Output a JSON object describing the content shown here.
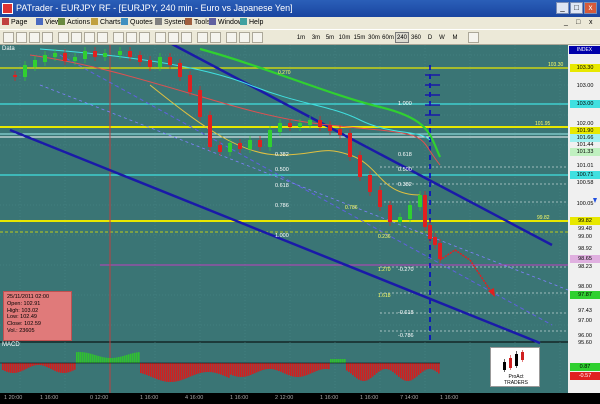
{
  "window": {
    "title": "PATrader - EURJPY RF - [EURJPY, 240 min - Euro vs Japanese Yen]",
    "minimize": "_",
    "maximize": "□",
    "close": "x"
  },
  "menu": [
    "Page",
    "View",
    "Actions",
    "Charts",
    "Quotes",
    "System",
    "Tools",
    "Window",
    "Help"
  ],
  "menu_right": {
    "minimize": "_",
    "restore": "□",
    "close": "x"
  },
  "toolbar": {
    "timeframes": [
      "1m",
      "3m",
      "5m",
      "10m",
      "15m",
      "30m",
      "60m",
      "240",
      "360"
    ],
    "periods": [
      "D",
      "W",
      "M"
    ]
  },
  "chart": {
    "panel_label": "Data",
    "macd_label": "MACD",
    "index_label": "INDEX",
    "info": {
      "date": "25/11/2011 02:00",
      "open": "Open: 102.91",
      "high": "High: 103.02",
      "low": "Low: 102.49",
      "close": "Close: 102.59",
      "vol": "Vol.: 23605"
    },
    "price_labels": [
      "103.30",
      "103.00",
      "102.00",
      "101.90",
      "101.66",
      "101.44",
      "101.33",
      "101.01",
      "100.71",
      "100.58",
      "100.05",
      "99.82",
      "99.48",
      "99.00",
      "98.92",
      "98.65",
      "98.23",
      "98.00",
      "97.87",
      "97.43",
      "97.00",
      "96.00",
      "95.60",
      "0.87",
      "-0.57"
    ],
    "fib_labels": [
      "0.270",
      "1.000",
      "0.382",
      "0.500",
      "0.618",
      "0.786",
      "1.000",
      "0.618",
      "0.500",
      "0.382",
      "0.236",
      "1.270",
      "1.618",
      "-0.618",
      "-0.786",
      "-0.270",
      "0.786"
    ],
    "level_tags": [
      "103.30",
      "101.95",
      "99.82"
    ],
    "x_labels": [
      "1 20:00",
      "1 16:00",
      "0 12:00",
      "1 16:00",
      "4 16:00",
      "1 16:00",
      "2 12:00",
      "1 16:00",
      "1 16:00",
      "7 14:00",
      "1 16:00"
    ],
    "logo_text": "ProAct\nTRADERS",
    "colors": {
      "channel": "#1a1aa8",
      "yellow_line": "#e8e800",
      "cyan_line": "#40e0e0",
      "green_ma": "#30d030",
      "bull": "#30d030",
      "bear": "#e02020",
      "macd_pos": "#30c030",
      "macd_neg": "#d02020"
    }
  }
}
